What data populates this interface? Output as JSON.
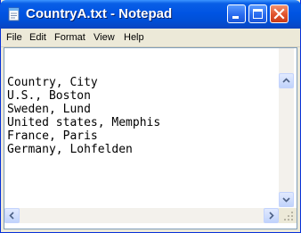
{
  "window": {
    "title": "CountryA.txt - Notepad",
    "icon": "notepad-icon",
    "controls": [
      "minimize-icon",
      "maximize-icon",
      "close-icon"
    ],
    "colors": {
      "titlebar": "#0054e3",
      "close": "#e0522c",
      "frame": "#ece9d8"
    }
  },
  "menu": {
    "file": "File",
    "edit": "Edit",
    "format": "Format",
    "view": "View",
    "help": "Help"
  },
  "document": {
    "lines": [
      "Country, City",
      "U.S., Boston",
      "Sweden, Lund",
      "United states, Memphis",
      "France, Paris",
      "Germany, Lohfelden"
    ]
  }
}
